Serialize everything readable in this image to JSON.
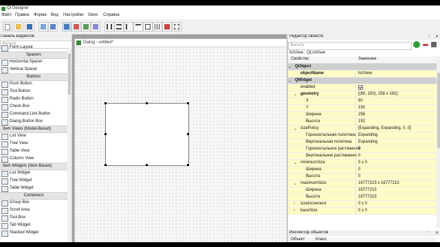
{
  "window": {
    "title": "Qt Designer"
  },
  "menu": [
    "Файл",
    "Правка",
    "Форма",
    "Вид",
    "Настройки",
    "Окно",
    "Справка"
  ],
  "widget_box": {
    "title": "Панель виджетов",
    "filter_placeholder": "Фильтр",
    "rows": [
      {
        "kind": "partial",
        "label": "Form Layout"
      },
      {
        "kind": "cat",
        "label": "Spacers"
      },
      {
        "kind": "item",
        "label": "Horizontal Spacer",
        "icon": "horizontal-spacer-icon"
      },
      {
        "kind": "item",
        "label": "Vertical Spacer",
        "icon": "vertical-spacer-icon"
      },
      {
        "kind": "cat",
        "label": "Buttons"
      },
      {
        "kind": "item",
        "label": "Push Button",
        "icon": "push-button-icon"
      },
      {
        "kind": "item",
        "label": "Tool Button",
        "icon": "tool-button-icon"
      },
      {
        "kind": "item",
        "label": "Radio Button",
        "icon": "radio-button-icon"
      },
      {
        "kind": "item",
        "label": "Check Box",
        "icon": "check-box-icon"
      },
      {
        "kind": "item",
        "label": "Command Link Button",
        "icon": "command-link-icon"
      },
      {
        "kind": "item",
        "label": "Dialog Button Box",
        "icon": "dialog-button-box-icon"
      },
      {
        "kind": "cat-left",
        "label": "Item Views (Model-Based)"
      },
      {
        "kind": "item",
        "label": "List View",
        "icon": "list-view-icon"
      },
      {
        "kind": "item",
        "label": "Tree View",
        "icon": "tree-view-icon"
      },
      {
        "kind": "item",
        "label": "Table View",
        "icon": "table-view-icon"
      },
      {
        "kind": "item",
        "label": "Column View",
        "icon": "column-view-icon"
      },
      {
        "kind": "cat-left",
        "label": "Item Widgets (Item-Based)"
      },
      {
        "kind": "item",
        "label": "List Widget",
        "icon": "list-widget-icon"
      },
      {
        "kind": "item",
        "label": "Tree Widget",
        "icon": "tree-widget-icon"
      },
      {
        "kind": "item",
        "label": "Table Widget",
        "icon": "table-widget-icon"
      },
      {
        "kind": "cat",
        "label": "Containers"
      },
      {
        "kind": "item",
        "label": "Group Box",
        "icon": "group-box-icon"
      },
      {
        "kind": "item",
        "label": "Scroll Area",
        "icon": "scroll-area-icon"
      },
      {
        "kind": "item",
        "label": "Tool Box",
        "icon": "tool-box-icon"
      },
      {
        "kind": "item",
        "label": "Tab Widget",
        "icon": "tab-widget-icon"
      },
      {
        "kind": "item",
        "label": "Stacked Widget",
        "icon": "stacked-widget-icon"
      }
    ]
  },
  "form": {
    "title": "Dialog - untitled*"
  },
  "property_editor": {
    "title": "Редактор свойств",
    "filter_placeholder": "Фильтр",
    "object_line": "listView : QListView",
    "col_property": "Свойство",
    "col_value": "Значение",
    "rows": [
      {
        "key": "QObject",
        "value": "",
        "style": "group",
        "indent": 0
      },
      {
        "key": "objectName",
        "value": "listView",
        "style": "yellow-bold",
        "indent": 1
      },
      {
        "key": "QWidget",
        "value": "",
        "style": "group",
        "indent": 0
      },
      {
        "key": "enabled",
        "value": "",
        "style": "yellow",
        "indent": 1,
        "checkbox": true
      },
      {
        "key": "geometry",
        "value": "[(90, 150), 256 x 192]",
        "style": "yellow-bold",
        "indent": 1,
        "arrow": "expanded"
      },
      {
        "key": "X",
        "value": "90",
        "style": "yellow",
        "indent": 2
      },
      {
        "key": "Y",
        "value": "150",
        "style": "yellow",
        "indent": 2
      },
      {
        "key": "Ширина",
        "value": "256",
        "style": "yellow",
        "indent": 2
      },
      {
        "key": "Высота",
        "value": "192",
        "style": "yellow",
        "indent": 2
      },
      {
        "key": "sizePolicy",
        "value": "[Expanding, Expanding, 0, 0]",
        "style": "yellow",
        "indent": 1,
        "arrow": "expanded"
      },
      {
        "key": "Горизонтальная политика",
        "value": "Expanding",
        "style": "yellow",
        "indent": 2
      },
      {
        "key": "Вертикальная политика",
        "value": "Expanding",
        "style": "yellow",
        "indent": 2
      },
      {
        "key": "Горизонтальное растяжение",
        "value": "0",
        "style": "yellow",
        "indent": 2
      },
      {
        "key": "Вертикальное растяжение",
        "value": "0",
        "style": "yellow",
        "indent": 2
      },
      {
        "key": "minimumSize",
        "value": "0 x 0",
        "style": "yellow",
        "indent": 1,
        "arrow": "expanded"
      },
      {
        "key": "Ширина",
        "value": "0",
        "style": "yellow",
        "indent": 2
      },
      {
        "key": "Высота",
        "value": "0",
        "style": "yellow",
        "indent": 2
      },
      {
        "key": "maximumSize",
        "value": "16777215 x 16777215",
        "style": "yellow",
        "indent": 1,
        "arrow": "expanded"
      },
      {
        "key": "Ширина",
        "value": "16777215",
        "style": "yellow",
        "indent": 2
      },
      {
        "key": "Высота",
        "value": "16777215",
        "style": "yellow",
        "indent": 2
      },
      {
        "key": "sizeIncrement",
        "value": "0 x 0",
        "style": "yellow",
        "indent": 1,
        "arrow": "collapsed"
      },
      {
        "key": "baseSize",
        "value": "0 x 0",
        "style": "yellow",
        "indent": 1,
        "arrow": "collapsed"
      }
    ]
  },
  "object_inspector": {
    "title": "Инспектор объектов",
    "col_object": "Объект",
    "col_class": "Класс",
    "rows": [
      {
        "object": "Dialog",
        "class": "QDialog",
        "selected": false
      },
      {
        "object": "li...ew",
        "class": "QListView",
        "selected": true
      }
    ]
  }
}
